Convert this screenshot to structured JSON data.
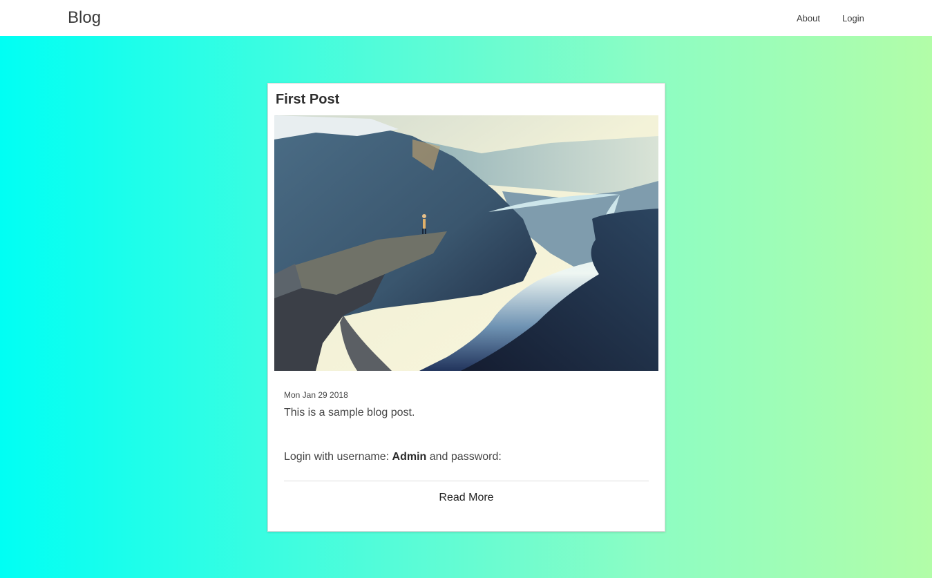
{
  "navbar": {
    "brand": "Blog",
    "links": [
      {
        "label": "About"
      },
      {
        "label": "Login"
      }
    ]
  },
  "colors": {
    "gradient_start": "#00fff4",
    "gradient_end": "#b2fda8",
    "card_background": "#ffffff"
  },
  "post": {
    "title": "First Post",
    "image_icon": "landscape-photo-fjord",
    "date": "Mon Jan 29 2018",
    "text": "This is a sample blog post.",
    "login_prefix": "Login with username: ",
    "login_username": "Admin",
    "login_suffix": " and password:",
    "read_more": "Read More"
  }
}
